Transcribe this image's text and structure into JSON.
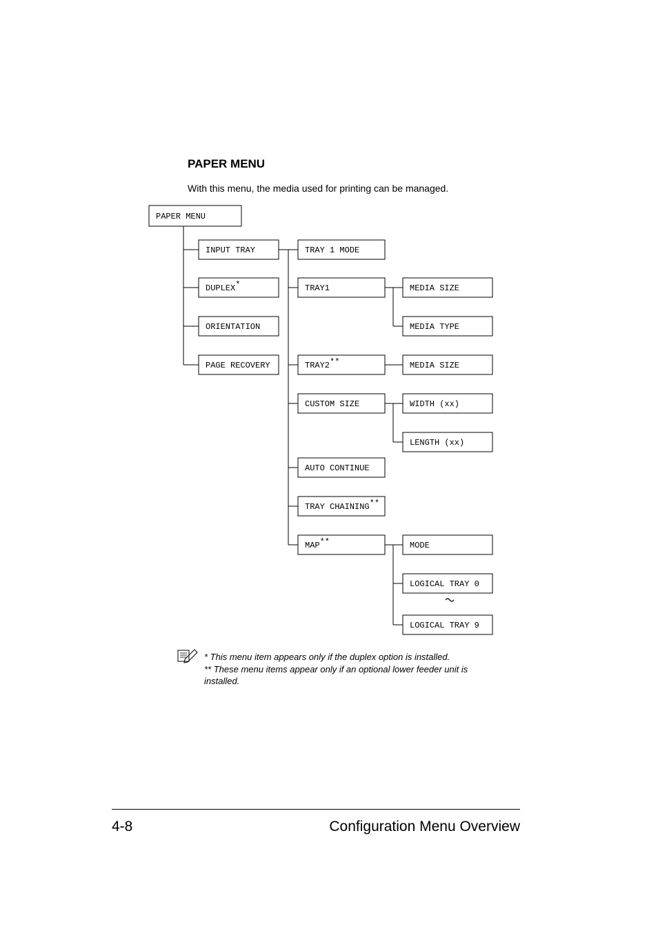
{
  "heading": "PAPER MENU",
  "intro": "With this menu, the media used for printing can be managed.",
  "boxes": {
    "paper_menu": "PAPER MENU",
    "input_tray": "INPUT TRAY",
    "duplex": "DUPLEX",
    "duplex_sup": "*",
    "orientation": "ORIENTATION",
    "page_recovery": "PAGE RECOVERY",
    "tray1_mode": "TRAY 1 MODE",
    "tray1": "TRAY1",
    "tray2": "TRAY2",
    "tray2_sup": "**",
    "custom_size": "CUSTOM SIZE",
    "auto_continue": "AUTO CONTINUE",
    "tray_chaining": "TRAY CHAINING",
    "tray_chaining_sup": "**",
    "map": "MAP",
    "map_sup": "**",
    "media_size": "MEDIA SIZE",
    "media_type": "MEDIA TYPE",
    "media_size2": "MEDIA SIZE",
    "width": "WIDTH (xx)",
    "length": "LENGTH (xx)",
    "mode": "MODE",
    "logical_0": "LOGICAL TRAY 0",
    "logical_9": "LOGICAL TRAY 9"
  },
  "note_line1": "* This menu item appears only if the duplex option is installed.",
  "note_line2": "** These menu items appear only if an optional lower feeder unit is installed.",
  "page_number": "4-8",
  "footer_title": "Configuration Menu Overview"
}
